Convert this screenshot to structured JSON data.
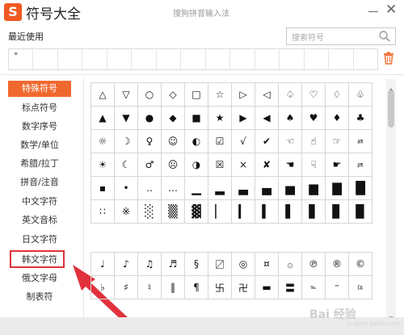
{
  "window": {
    "logo_glyph": "S",
    "title": "符号大全",
    "ime_title": "搜狗拼音输入法",
    "close_glyph": "✕",
    "accent_color": "#f0692f",
    "highlight_color": "#e1313c"
  },
  "recent": {
    "label": "最近使用",
    "cells": [
      "°",
      "",
      "",
      "",
      "",
      "",
      "",
      "",
      "",
      "",
      "",
      "",
      "",
      "",
      ""
    ]
  },
  "search": {
    "placeholder": "搜索符号"
  },
  "sidebar": {
    "active_index": 0,
    "items": [
      {
        "label": "特殊符号"
      },
      {
        "label": "标点符号"
      },
      {
        "label": "数字序号"
      },
      {
        "label": "数学/单位"
      },
      {
        "label": "希腊/拉丁"
      },
      {
        "label": "拼音/注音"
      },
      {
        "label": "中文字符"
      },
      {
        "label": "英文音标"
      },
      {
        "label": "日文字符"
      },
      {
        "label": "韩文字符"
      },
      {
        "label": "俄文字母"
      },
      {
        "label": "制表符"
      }
    ]
  },
  "grid1": [
    [
      "△",
      "▽",
      "○",
      "◇",
      "□",
      "☆",
      "▷",
      "◁",
      "♤",
      "♡",
      "♢",
      "♧"
    ],
    [
      "▲",
      "▼",
      "●",
      "◆",
      "■",
      "★",
      "▶",
      "◀",
      "♠",
      "♥",
      "♦",
      "♣"
    ],
    [
      "☼",
      "☽",
      "♀",
      "☺",
      "◐",
      "☑",
      "√",
      "✔",
      "☜",
      "☝",
      "☞",
      "㏂"
    ],
    [
      "☀",
      "☾",
      "♂",
      "☹",
      "◑",
      "☒",
      "×",
      "✘",
      "☚",
      "☟",
      "☛",
      "㏘"
    ],
    [
      "▪",
      "•",
      "‥",
      "…",
      "▁",
      "▂",
      "▃",
      "▄",
      "▅",
      "▆",
      "▇",
      "█"
    ],
    [
      "∷",
      "※",
      "░",
      "▒",
      "▓",
      "▏",
      "▎",
      "▍",
      "▌",
      "▋",
      "▊",
      "▉"
    ]
  ],
  "grid2": [
    [
      "♩",
      "♪",
      "♫",
      "♬",
      "§",
      "〼",
      "◎",
      "¤",
      "۞",
      "℗",
      "®",
      "©"
    ],
    [
      "♭",
      "♯",
      "♮",
      "‖",
      "¶",
      "卐",
      "卍",
      "▬",
      "〓",
      "℡",
      "™",
      "㏇"
    ]
  ],
  "watermark": {
    "text": "Bai 经验",
    "sub": "jingyan.baidu.com"
  }
}
